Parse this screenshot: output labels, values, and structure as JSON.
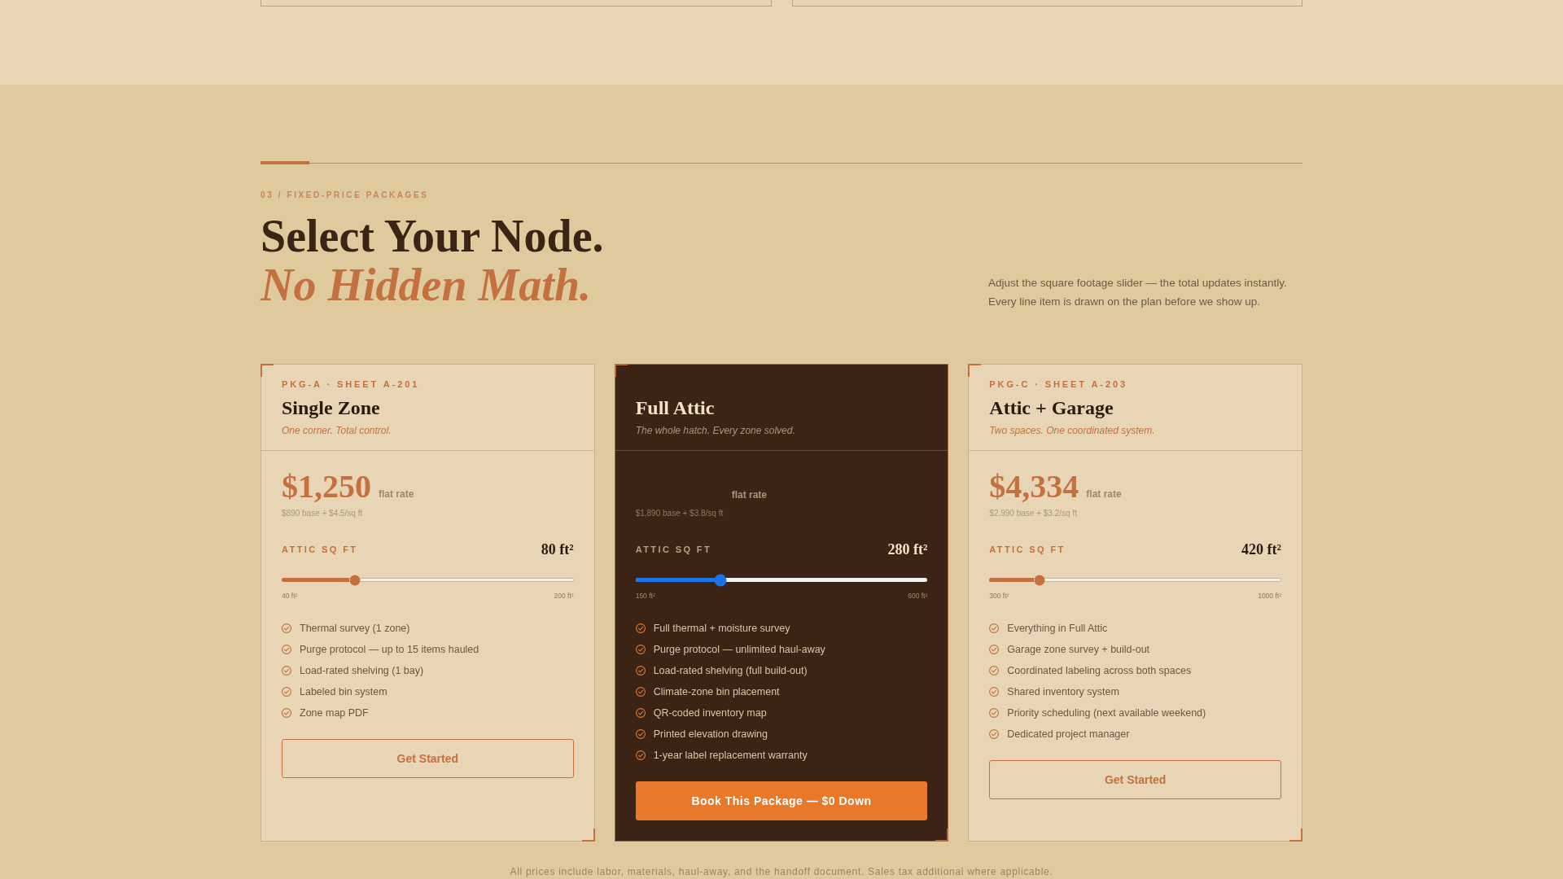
{
  "section": {
    "eyebrow": "03 / FIXED-PRICE PACKAGES",
    "title": "Select Your Node.",
    "title_accent": "No Hidden Math.",
    "intro": "Adjust the square footage slider — the total updates instantly. Every line item is drawn on the plan before we show up."
  },
  "packages": [
    {
      "featured": false,
      "code": "PKG-A · SHEET A-201",
      "name": "Single Zone",
      "tagline": "One corner. Total control.",
      "price": "$1,250",
      "price_unit": "flat rate",
      "price_basis": "$890 base + $4.5/sq ft",
      "slider": {
        "label": "ATTIC SQ FT",
        "reading": "80 ft²",
        "level": 0.25,
        "min_label": "40 ft²",
        "max_label": "200 ft²"
      },
      "features": [
        "Thermal survey (1 zone)",
        "Purge protocol — up to 15 items hauled",
        "Load-rated shelving (1 bay)",
        "Labeled bin system",
        "Zone map PDF"
      ],
      "button": "Get Started"
    },
    {
      "featured": true,
      "name": "Full Attic",
      "tagline": "The whole hatch. Every zone solved.",
      "price_unit": "flat rate",
      "price_basis": "$1,890 base + $3.8/sq ft",
      "slider": {
        "label": "ATTIC SQ FT",
        "reading": "280 ft²",
        "level": 0.29,
        "min_label": "150 ft²",
        "max_label": "600 ft²"
      },
      "features": [
        "Full thermal + moisture survey",
        "Purge protocol — unlimited haul-away",
        "Load-rated shelving (full build-out)",
        "Climate-zone bin placement",
        "QR-coded inventory map",
        "Printed elevation drawing",
        "1-year label replacement warranty"
      ],
      "button": "Book This Package — $0 Down"
    },
    {
      "featured": false,
      "code": "PKG-C · SHEET A-203",
      "name": "Attic + Garage",
      "tagline": "Two spaces. One coordinated system.",
      "price": "$4,334",
      "price_unit": "flat rate",
      "price_basis": "$2,990 base + $3.2/sq ft",
      "slider": {
        "label": "ATTIC SQ FT",
        "reading": "420 ft²",
        "level": 0.17,
        "min_label": "300 ft²",
        "max_label": "1000 ft²"
      },
      "features": [
        "Everything in Full Attic",
        "Garage zone survey + build-out",
        "Coordinated labeling across both spaces",
        "Shared inventory system",
        "Priority scheduling (next available weekend)",
        "Dedicated project manager"
      ],
      "button": "Get Started"
    }
  ],
  "footnote": "All prices include labor, materials, haul-away, and the handoff document. Sales tax additional where applicable."
}
